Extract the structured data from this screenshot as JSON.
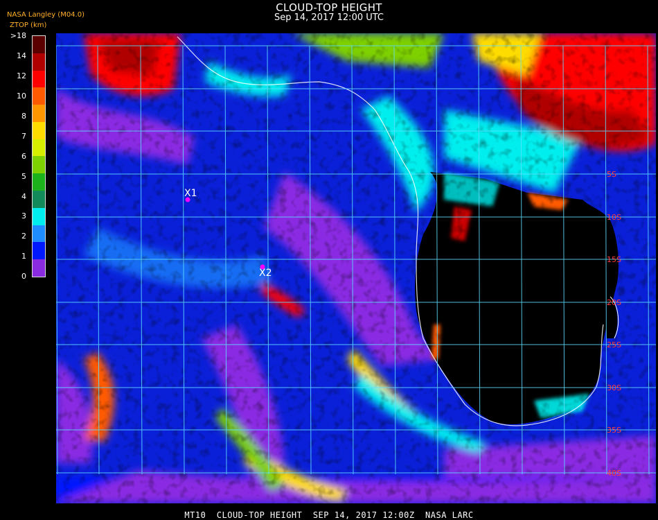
{
  "header": {
    "title": "CLOUD-TOP HEIGHT",
    "subtitle": "Sep 14, 2017 12:00 UTC",
    "source": "NASA Langley (M04.0)",
    "units": "ZTOP (km)"
  },
  "colorbar": {
    "labels": [
      ">18",
      "14",
      "12",
      "10",
      "8",
      "7",
      "6",
      "5",
      "4",
      "3",
      "2",
      "1",
      "0"
    ],
    "colors": [
      "#5a0000",
      "#b00000",
      "#ff0000",
      "#ff5a00",
      "#ff9600",
      "#ffdc00",
      "#d6ef00",
      "#7ed000",
      "#1bb21b",
      "#138a5a",
      "#00eeee",
      "#1e8cff",
      "#0018ff",
      "#8a2be2"
    ]
  },
  "markers": [
    {
      "label": "X1",
      "color": "#ff00ff"
    },
    {
      "label": "X2",
      "color": "#ff00ff"
    }
  ],
  "lat_labels": [
    "5S",
    "10S",
    "15S",
    "20S",
    "25S",
    "30S",
    "35S",
    "40S"
  ],
  "footer": "MT10  CLOUD-TOP HEIGHT  SEP 14, 2017 12:00Z  NASA LARC"
}
